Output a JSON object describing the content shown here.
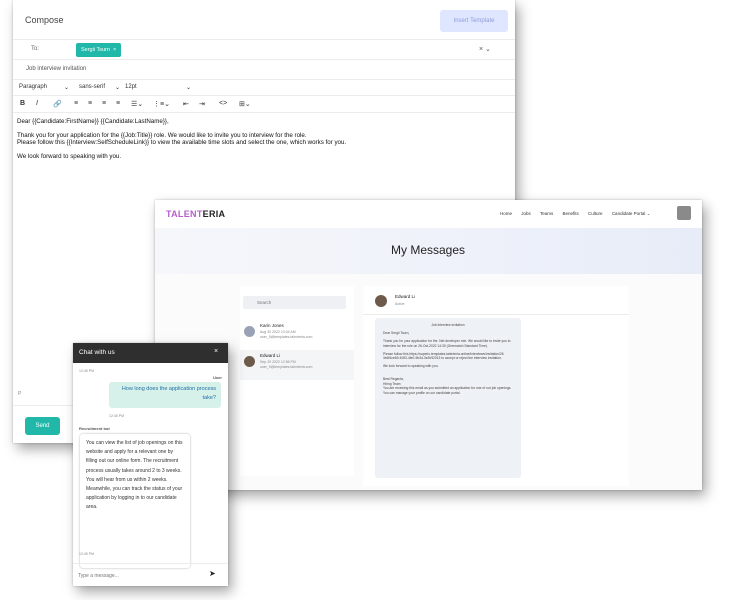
{
  "compose": {
    "title": "Compose",
    "insert_template": "Insert Template",
    "to_label": "To:",
    "recipient": "Sergii Tsurn",
    "chip_remove": "×",
    "to_controls": "× ⌄",
    "subject": "Job interview invitation",
    "format": {
      "block": "Paragraph",
      "font": "sans-serif",
      "size": "12pt",
      "chevron": "⌄"
    },
    "toolbar": {
      "bold": "B",
      "italic": "I",
      "link": "🔗",
      "align_left": "≡",
      "align_center": "≡",
      "align_right": "≡",
      "justify": "≡",
      "bullets": "☰⌄",
      "numbers": "⋮≡⌄",
      "outdent": "⇤",
      "indent": "⇥",
      "code": "<>",
      "table": "⊞⌄"
    },
    "body": {
      "greeting": "Dear {{Candidate:FirstName}} {{Candidate:LastName}},",
      "line1": "Thank you for your application for the {{Job:Title}} role. We would like to invite you to interview for the role.",
      "line2": "Please follow this {{Interview:SelfScheduleLink}} to view the available time slots and select the one, which works for you.",
      "line3": "We look forward to speaking with you."
    },
    "path": "P",
    "send": "Send"
  },
  "messages": {
    "logo_part1": "TALENT",
    "logo_part2": "ERIA",
    "nav": [
      "Home",
      "Jobs",
      "Teams",
      "Benefits",
      "Culture",
      "Candidate Portal ⌄"
    ],
    "title": "My Messages",
    "search_placeholder": "Search",
    "search_icon": "⌕",
    "contacts": [
      {
        "name": "Karin Jones",
        "date": "Aug 30 2022 10:04 AM",
        "email": "user_5@templates.talenteria.com"
      },
      {
        "name": "Edward Li",
        "date": "Sep 29 2022 12:56 PM",
        "email": "user_9@templates.talenteria.com"
      }
    ],
    "thread": {
      "name": "Edward Li",
      "status": "Active",
      "subject": "Job interview invitation",
      "greeting": "Dear Sergii Tsurn,",
      "p1": "Thank you for your application for the .Net developer role. We would like to invite you to interview for the role on 26-Oct-2022 14:30 (Greenwich Standard Time).",
      "p2": "Please follow this https://superio.templates.talenteria.online/interviews/invitation/26 3e6f4ce69-4083-4fe0-9b3d-3e2b92013 to accept or reject the interview invitation.",
      "p3": "We look forward to speaking with you.",
      "sign1": "Best Regards,",
      "sign2": "Hiring Team",
      "footer": "You are receiving this email as you submitted an application for one of our job openings. You can manage your profile on our candidate portal."
    }
  },
  "chat": {
    "title": "Chat with us",
    "close": "×",
    "time1": "12:45 PM",
    "user_label": "User",
    "user_msg": "How long does the application process take?",
    "time2": "12:45 PM",
    "bot_label": "Recruitment bot",
    "bot_msg": "You can view the list of job openings on this website and apply for a relevant one by filling out our online form. The recruitment process usually takes around 2 to 3 weeks. You will hear from us within 2 weeks. Meanwhile, you can track the status of your application by logging in to our candidate area.",
    "time3": "12:45 PM",
    "input_placeholder": "Type a message...",
    "send_icon": "➤"
  }
}
